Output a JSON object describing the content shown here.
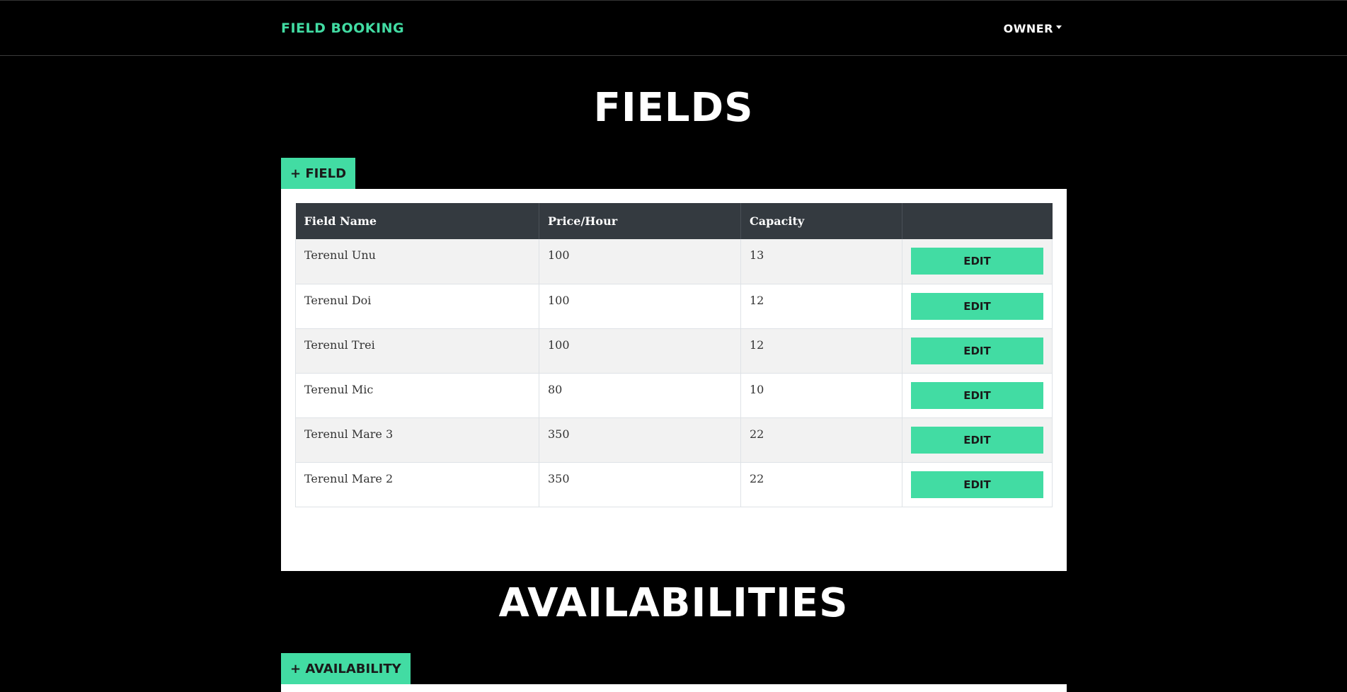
{
  "navbar": {
    "brand": "FIELD BOOKING",
    "user_menu": "OWNER"
  },
  "fields_section": {
    "title": "FIELDS",
    "add_button": "+ FIELD",
    "columns": [
      "Field Name",
      "Price/Hour",
      "Capacity",
      ""
    ],
    "edit_label": "EDIT",
    "rows": [
      {
        "name": "Terenul Unu",
        "price": "100",
        "capacity": "13"
      },
      {
        "name": "Terenul Doi",
        "price": "100",
        "capacity": "12"
      },
      {
        "name": "Terenul Trei",
        "price": "100",
        "capacity": "12"
      },
      {
        "name": "Terenul Mic",
        "price": "80",
        "capacity": "10"
      },
      {
        "name": "Terenul Mare 3",
        "price": "350",
        "capacity": "22"
      },
      {
        "name": "Terenul Mare 2",
        "price": "350",
        "capacity": "22"
      }
    ]
  },
  "availabilities_section": {
    "title": "AVAILABILITIES",
    "add_button": "+ AVAILABILITY"
  },
  "colors": {
    "accent": "#42dca3",
    "background": "#000000",
    "table_header": "#343a40"
  }
}
